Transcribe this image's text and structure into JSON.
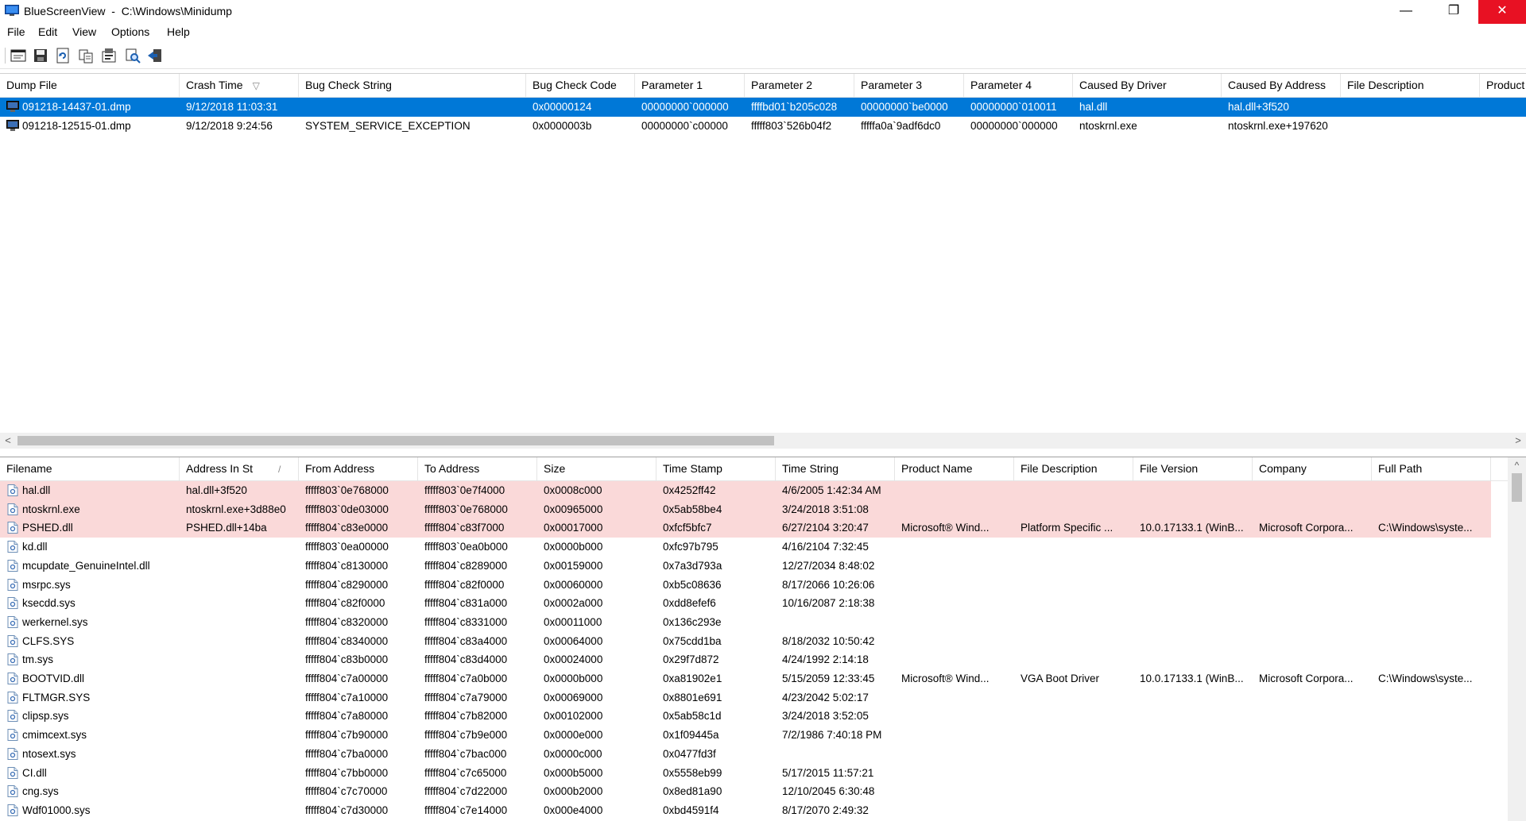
{
  "window": {
    "app_name": "BlueScreenView",
    "path": "C:\\Windows\\Minidump",
    "title": "BlueScreenView  -  C:\\Windows\\Minidump"
  },
  "titlebar_buttons": {
    "minimize": "—",
    "restore": "❐",
    "close": "✕"
  },
  "menu": [
    "File",
    "Edit",
    "View",
    "Options",
    "Help"
  ],
  "toolbar_icons": [
    "html-report-icon",
    "save-icon",
    "refresh-icon",
    "copy-icon",
    "properties-icon",
    "find-icon",
    "exit-icon"
  ],
  "crash_table": {
    "columns": [
      "Dump File",
      "Crash Time",
      "Bug Check String",
      "Bug Check Code",
      "Parameter 1",
      "Parameter 2",
      "Parameter 3",
      "Parameter 4",
      "Caused By Driver",
      "Caused By Address",
      "File Description",
      "Product"
    ],
    "sorted_column": "Crash Time",
    "sort_indicator": "▽",
    "rows": [
      [
        "091218-14437-01.dmp",
        "9/12/2018 11:03:31",
        "",
        "0x00000124",
        "00000000`000000",
        "ffffbd01`b205c028",
        "00000000`be0000",
        "00000000`010011",
        "hal.dll",
        "hal.dll+3f520",
        "",
        ""
      ],
      [
        "091218-12515-01.dmp",
        "9/12/2018 9:24:56",
        "SYSTEM_SERVICE_EXCEPTION",
        "0x0000003b",
        "00000000`c00000",
        "fffff803`526b04f2",
        "fffffa0a`9adf6dc0",
        "00000000`000000",
        "ntoskrnl.exe",
        "ntoskrnl.exe+197620",
        "",
        ""
      ]
    ],
    "selected_row": 0
  },
  "scroll_arrows": {
    "left": "<",
    "right": ">",
    "up": "^"
  },
  "driver_table": {
    "columns": [
      "Filename",
      "Address In St",
      "From Address",
      "To Address",
      "Size",
      "Time Stamp",
      "Time String",
      "Product Name",
      "File Description",
      "File Version",
      "Company",
      "Full Path"
    ],
    "sort_indicator": "/",
    "rows": [
      [
        "hal.dll",
        "hal.dll+3f520",
        "fffff803`0e768000",
        "fffff803`0e7f4000",
        "0x0008c000",
        "0x4252ff42",
        "4/6/2005 1:42:34 AM",
        "",
        "",
        "",
        "",
        ""
      ],
      [
        "ntoskrnl.exe",
        "ntoskrnl.exe+3d88e0",
        "fffff803`0de03000",
        "fffff803`0e768000",
        "0x00965000",
        "0x5ab58be4",
        "3/24/2018 3:51:08",
        "",
        "",
        "",
        "",
        ""
      ],
      [
        "PSHED.dll",
        "PSHED.dll+14ba",
        "fffff804`c83e0000",
        "fffff804`c83f7000",
        "0x00017000",
        "0xfcf5bfc7",
        "6/27/2104 3:20:47",
        "Microsoft® Wind...",
        "Platform Specific ...",
        "10.0.17133.1 (WinB...",
        "Microsoft Corpora...",
        "C:\\Windows\\syste..."
      ],
      [
        "kd.dll",
        "",
        "fffff803`0ea00000",
        "fffff803`0ea0b000",
        "0x0000b000",
        "0xfc97b795",
        "4/16/2104 7:32:45",
        "",
        "",
        "",
        "",
        ""
      ],
      [
        "mcupdate_GenuineIntel.dll",
        "",
        "fffff804`c8130000",
        "fffff804`c8289000",
        "0x00159000",
        "0x7a3d793a",
        "12/27/2034 8:48:02",
        "",
        "",
        "",
        "",
        ""
      ],
      [
        "msrpc.sys",
        "",
        "fffff804`c8290000",
        "fffff804`c82f0000",
        "0x00060000",
        "0xb5c08636",
        "8/17/2066 10:26:06",
        "",
        "",
        "",
        "",
        ""
      ],
      [
        "ksecdd.sys",
        "",
        "fffff804`c82f0000",
        "fffff804`c831a000",
        "0x0002a000",
        "0xdd8efef6",
        "10/16/2087 2:18:38",
        "",
        "",
        "",
        "",
        ""
      ],
      [
        "werkernel.sys",
        "",
        "fffff804`c8320000",
        "fffff804`c8331000",
        "0x00011000",
        "0x136c293e",
        "",
        "",
        "",
        "",
        "",
        ""
      ],
      [
        "CLFS.SYS",
        "",
        "fffff804`c8340000",
        "fffff804`c83a4000",
        "0x00064000",
        "0x75cdd1ba",
        "8/18/2032 10:50:42",
        "",
        "",
        "",
        "",
        ""
      ],
      [
        "tm.sys",
        "",
        "fffff804`c83b0000",
        "fffff804`c83d4000",
        "0x00024000",
        "0x29f7d872",
        "4/24/1992 2:14:18",
        "",
        "",
        "",
        "",
        ""
      ],
      [
        "BOOTVID.dll",
        "",
        "fffff804`c7a00000",
        "fffff804`c7a0b000",
        "0x0000b000",
        "0xa81902e1",
        "5/15/2059 12:33:45",
        "Microsoft® Wind...",
        "VGA Boot Driver",
        "10.0.17133.1 (WinB...",
        "Microsoft Corpora...",
        "C:\\Windows\\syste..."
      ],
      [
        "FLTMGR.SYS",
        "",
        "fffff804`c7a10000",
        "fffff804`c7a79000",
        "0x00069000",
        "0x8801e691",
        "4/23/2042 5:02:17",
        "",
        "",
        "",
        "",
        ""
      ],
      [
        "clipsp.sys",
        "",
        "fffff804`c7a80000",
        "fffff804`c7b82000",
        "0x00102000",
        "0x5ab58c1d",
        "3/24/2018 3:52:05",
        "",
        "",
        "",
        "",
        ""
      ],
      [
        "cmimcext.sys",
        "",
        "fffff804`c7b90000",
        "fffff804`c7b9e000",
        "0x0000e000",
        "0x1f09445a",
        "7/2/1986 7:40:18 PM",
        "",
        "",
        "",
        "",
        ""
      ],
      [
        "ntosext.sys",
        "",
        "fffff804`c7ba0000",
        "fffff804`c7bac000",
        "0x0000c000",
        "0x0477fd3f",
        "",
        "",
        "",
        "",
        "",
        ""
      ],
      [
        "CI.dll",
        "",
        "fffff804`c7bb0000",
        "fffff804`c7c65000",
        "0x000b5000",
        "0x5558eb99",
        "5/17/2015 11:57:21",
        "",
        "",
        "",
        "",
        ""
      ],
      [
        "cng.sys",
        "",
        "fffff804`c7c70000",
        "fffff804`c7d22000",
        "0x000b2000",
        "0x8ed81a90",
        "12/10/2045 6:30:48",
        "",
        "",
        "",
        "",
        ""
      ],
      [
        "Wdf01000.sys",
        "",
        "fffff804`c7d30000",
        "fffff804`c7e14000",
        "0x000e4000",
        "0xbd4591f4",
        "8/17/2070 2:49:32",
        "",
        "",
        "",
        "",
        ""
      ]
    ],
    "highlighted_rows": [
      0,
      1,
      2
    ]
  },
  "colors": {
    "selection": "#0078d7",
    "highlight": "#fad9d9",
    "close_button": "#e81123"
  }
}
